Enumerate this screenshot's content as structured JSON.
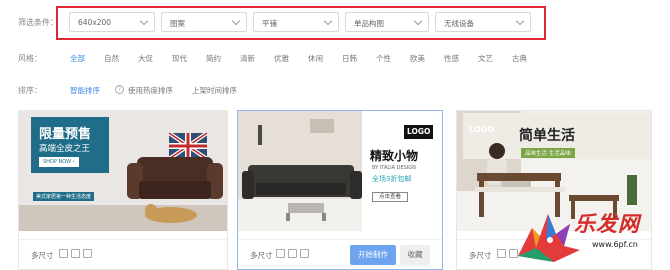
{
  "filter": {
    "label": "筛选条件：",
    "selects": [
      {
        "value": "640x200"
      },
      {
        "value": "图案"
      },
      {
        "value": "平铺"
      },
      {
        "value": "单品构图"
      },
      {
        "value": "无线设备"
      }
    ]
  },
  "style": {
    "label": "风格：",
    "items": [
      "全部",
      "自然",
      "大促",
      "现代",
      "简约",
      "清新",
      "优雅",
      "休闲",
      "日韩",
      "个性",
      "欧美",
      "性感",
      "文艺",
      "古典"
    ],
    "active_index": 0
  },
  "sort": {
    "label": "排序：",
    "items": [
      "智能排序",
      "使用热度排序",
      "上架时间排序"
    ],
    "active_index": 0,
    "help": "?"
  },
  "cards": [
    {
      "banner": {
        "title": "限量预售",
        "subtitle": "高端全皮之王",
        "button": "SHOP NOW ›",
        "tag": "美式家居第一种生活态度"
      },
      "size_label": "多尺寸"
    },
    {
      "banner": {
        "logo": "LOGO",
        "title": "精致小物",
        "brand": "BY ITALIA DESIGN",
        "promo": "全场3折包邮",
        "button": "点击查看"
      },
      "size_label": "多尺寸",
      "make_label": "开始制作",
      "fav_label": "收藏"
    },
    {
      "banner": {
        "logo": "LOGO",
        "title": "简单生活",
        "tagline": "品味生活  生活品味"
      },
      "size_label": "多尺寸"
    }
  ],
  "watermark": {
    "text": "乐发网",
    "url": "www.6pf.cn"
  },
  "colors": {
    "accent": "#3d8bea",
    "highlight_border": "#e0262e",
    "primary_button": "#6ea3f0"
  }
}
